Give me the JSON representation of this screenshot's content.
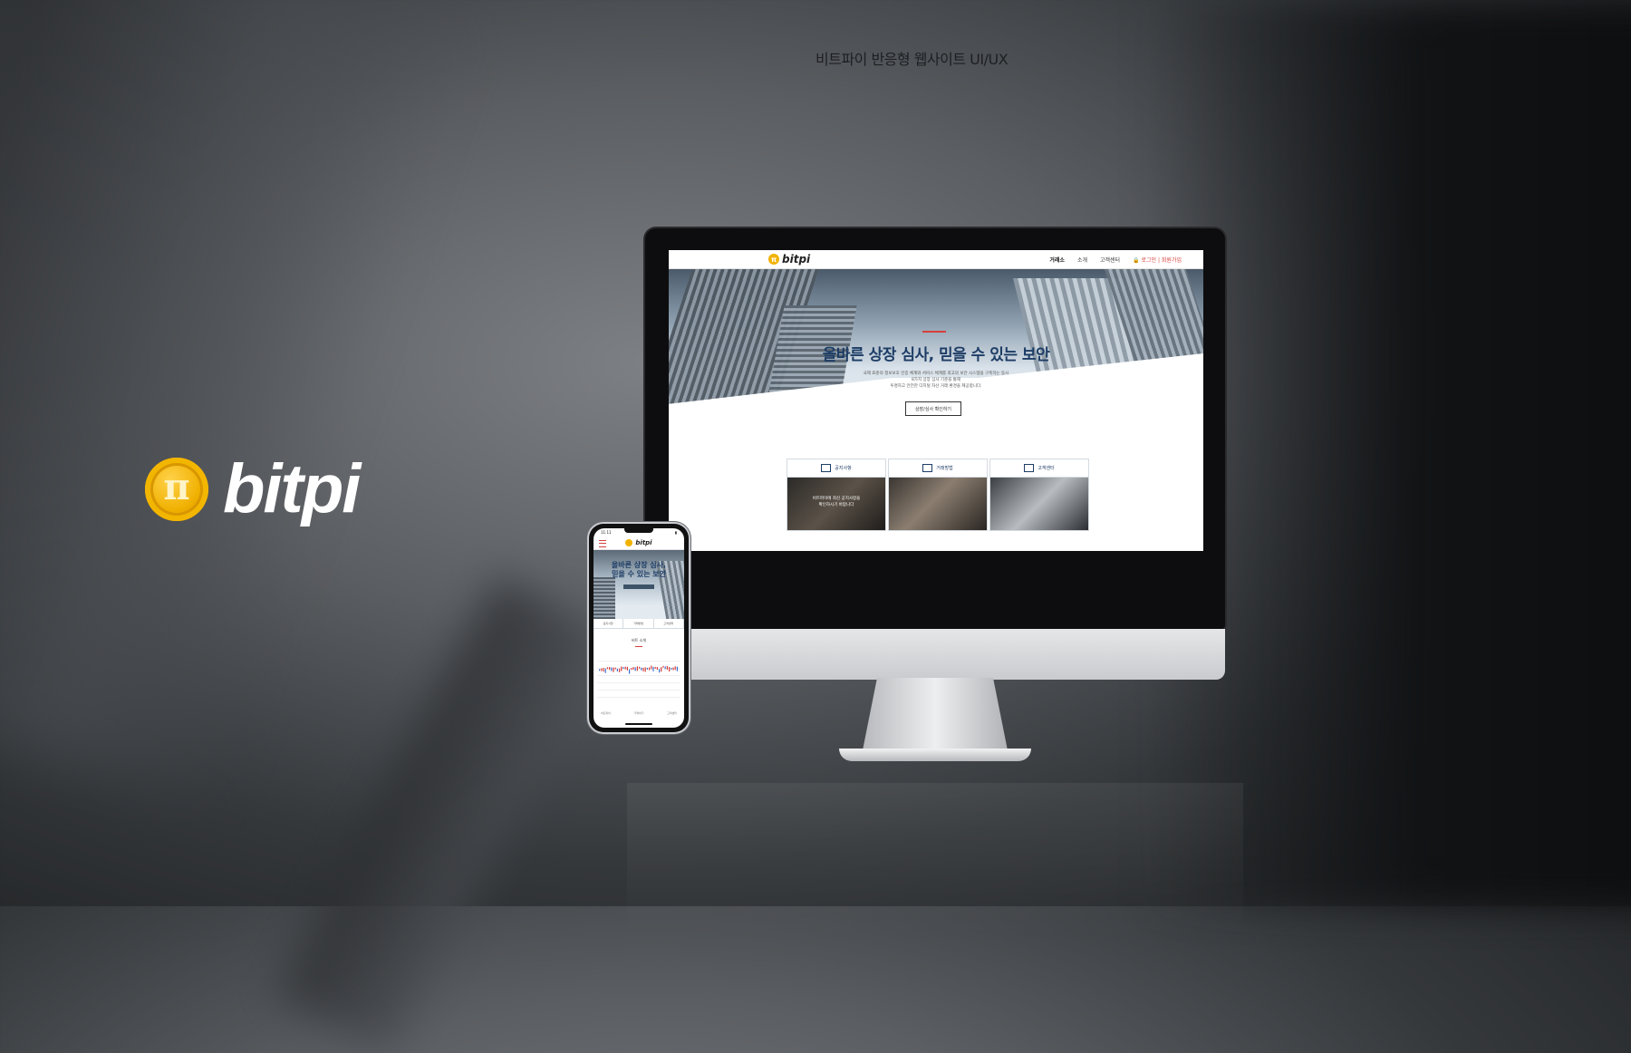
{
  "page": {
    "title": "비트파이 반응형 웹사이트 UI/UX"
  },
  "brand": {
    "symbol": "π",
    "name": "bitpi",
    "accent": "#f2b300"
  },
  "desktop": {
    "nav": {
      "logo_text": "bitpi",
      "items": [
        "거래소",
        "소개",
        "고객센터"
      ],
      "login": "로그인",
      "signup": "회원가입"
    },
    "hero": {
      "headline": "올바른 상장 심사, 믿을 수 있는 보안",
      "description_lines": [
        "국제 표준의 정보보호 인증 체계와 서비스 체계를 최고의 보안 시스템을 구축하는 동시",
        "8가지 상장 심사 기준을 통해",
        "투명하고 안전한 디지털 자산 거래 환경을 제공합니다."
      ],
      "cta": "상장/심사 확인하기"
    },
    "cards": [
      {
        "label": "공지사항",
        "overlay": ""
      },
      {
        "label": "거래방법",
        "overlay": ""
      },
      {
        "label": "고객센터",
        "overlay": ""
      }
    ],
    "card_overlay_lines": [
      "비트파이에 최신 공지사항을",
      "확인하시기 바랍니다"
    ]
  },
  "mobile": {
    "status_time": "11:11",
    "logo_text": "bitpi",
    "headline_line1": "올바른 상장 심사,",
    "headline_line2": "믿을 수 있는 보안",
    "tabs": [
      "공지사항",
      "거래방법",
      "고객센터"
    ],
    "section_title": "비트 소개",
    "footer_left": "비트파이",
    "footer_mid": "거래하기",
    "footer_right": "고객센터"
  },
  "colors": {
    "accent_red": "#d6403a",
    "navy": "#1d3d66"
  }
}
